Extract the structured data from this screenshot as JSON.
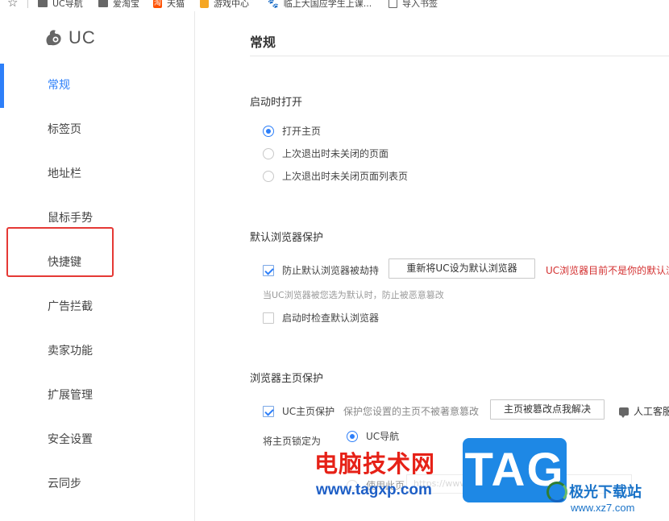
{
  "bookmarks": [
    {
      "label": "",
      "icon": "star-icon"
    },
    {
      "label": "UC导航",
      "icon": "folder-icon"
    },
    {
      "label": "爱淘宝",
      "icon": "folder-icon"
    },
    {
      "label": "天猫",
      "icon": "taobao-icon",
      "glyph": "淘"
    },
    {
      "label": "游戏中心",
      "icon": "game-icon"
    },
    {
      "label": "临上大国应学生上课...",
      "icon": "paw-icon",
      "glyph": "🐾"
    },
    {
      "label": "导入书签",
      "icon": "import-icon"
    }
  ],
  "sidebar": {
    "logo_text": "UC",
    "items": [
      {
        "label": "常规",
        "active": true
      },
      {
        "label": "标签页",
        "active": false
      },
      {
        "label": "地址栏",
        "active": false
      },
      {
        "label": "鼠标手势",
        "active": false
      },
      {
        "label": "快捷键",
        "active": false,
        "highlighted": true
      },
      {
        "label": "广告拦截",
        "active": false
      },
      {
        "label": "卖家功能",
        "active": false
      },
      {
        "label": "扩展管理",
        "active": false
      },
      {
        "label": "安全设置",
        "active": false
      },
      {
        "label": "云同步",
        "active": false
      }
    ]
  },
  "main": {
    "title": "常规",
    "startup": {
      "title": "启动时打开",
      "options": [
        {
          "label": "打开主页",
          "selected": true
        },
        {
          "label": "上次退出时未关闭的页面",
          "selected": false
        },
        {
          "label": "上次退出时未关闭页面列表页",
          "selected": false
        }
      ]
    },
    "default_browser": {
      "title": "默认浏览器保护",
      "prevent_hijack_label": "防止默认浏览器被劫持",
      "prevent_hijack_checked": true,
      "reset_button": "重新将UC设为默认浏览器",
      "warning": "UC浏览器目前不是你的默认浏览器",
      "hint": "当UC浏览器被您选为默认时，防止被恶意篡改",
      "check_on_start_label": "启动时检查默认浏览器",
      "check_on_start_checked": false
    },
    "homepage": {
      "title": "浏览器主页保护",
      "protect_label": "UC主页保护",
      "protect_checked": true,
      "protect_hint": "保护您设置的主页不被著意篡改",
      "fix_button": "主页被篡改点我解决",
      "service_label": "人工客服",
      "lock_label": "将主页锁定为",
      "lock_options": [
        {
          "label": "UC导航",
          "selected": true
        },
        {
          "label": "使用此页",
          "selected": false
        }
      ],
      "url_placeholder": "https://www.uc"
    }
  },
  "watermark": {
    "cn_text": "电脑技术网",
    "url": "www.tagxp.com",
    "tag": "TAG",
    "xz_text": "极光下载站",
    "xz_url": "www.xz7.com"
  },
  "colors": {
    "accent": "#2d7ff9",
    "warning": "#d32f2f",
    "highlight_box": "#e53935"
  }
}
